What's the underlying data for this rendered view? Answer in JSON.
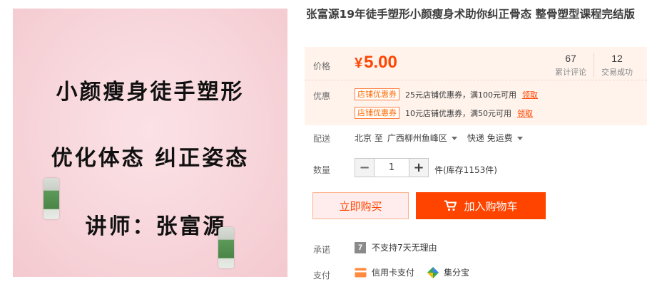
{
  "image": {
    "line1": "小颜瘦身徒手塑形",
    "line2": "优化体态 纠正姿态",
    "line3": "讲师：张富源",
    "colors": {
      "background": "#f8d8dd",
      "text": "#111111"
    }
  },
  "title": "张富源19年徒手塑形小颜瘦身术助你纠正骨态 整骨塑型课程完结版",
  "price": {
    "label": "价格",
    "currency": "¥",
    "value": "5.00"
  },
  "stats": [
    {
      "num": "67",
      "label": "累计评论"
    },
    {
      "num": "12",
      "label": "交易成功"
    }
  ],
  "promo": {
    "label": "优惠",
    "coupons": [
      {
        "tag": "店铺优惠券",
        "text": "25元店铺优惠券，满100元可用",
        "claim": "领取"
      },
      {
        "tag": "店铺优惠券",
        "text": "10元店铺优惠券，满50元可用",
        "claim": "领取"
      }
    ]
  },
  "delivery": {
    "label": "配送",
    "from": "北京 至",
    "to": "广西柳州鱼峰区",
    "method": "快递 免运费"
  },
  "quantity": {
    "label": "数量",
    "value": "1",
    "stock": "件(库存1153件)"
  },
  "actions": {
    "buy": "立即购买",
    "cart": "加入购物车"
  },
  "promise": {
    "label": "承诺",
    "icon_text": "7",
    "text": "不支持7天无理由"
  },
  "payment": {
    "label": "支付",
    "methods": [
      "信用卡支付",
      "集分宝"
    ]
  },
  "colors": {
    "accent": "#ff4400",
    "price_bg": "#fff3ec",
    "buy_bg": "#ffeded"
  }
}
